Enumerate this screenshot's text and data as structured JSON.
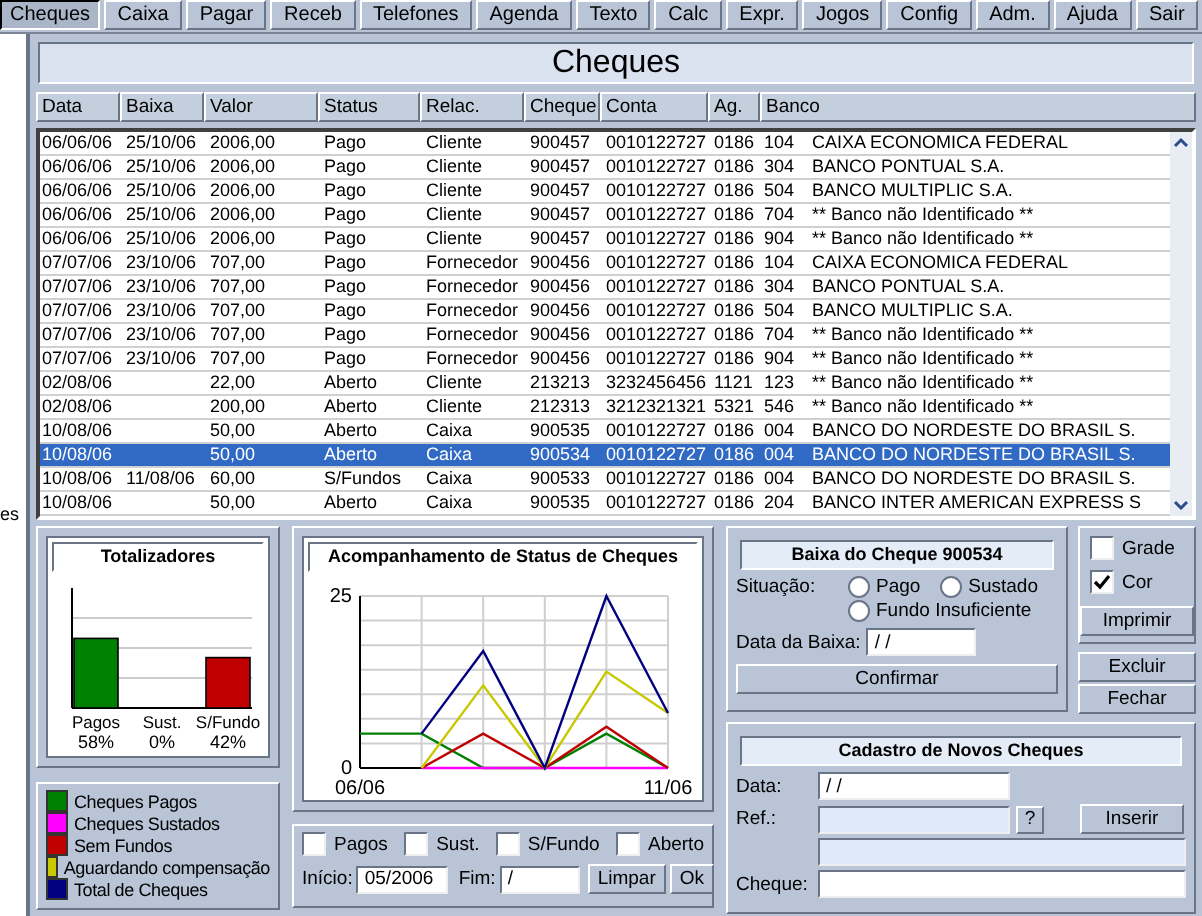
{
  "menu": [
    {
      "label": "Cheques",
      "selected": true
    },
    {
      "label": "Caixa",
      "selected": false
    },
    {
      "label": "Pagar",
      "selected": false
    },
    {
      "label": "Receb",
      "selected": false
    },
    {
      "label": "Telefones",
      "selected": false
    },
    {
      "label": "Agenda",
      "selected": false
    },
    {
      "label": "Texto",
      "selected": false
    },
    {
      "label": "Calc",
      "selected": false
    },
    {
      "label": "Expr.",
      "selected": false
    },
    {
      "label": "Jogos",
      "selected": false
    },
    {
      "label": "Config",
      "selected": false
    },
    {
      "label": "Adm.",
      "selected": false
    },
    {
      "label": "Ajuda",
      "selected": false
    },
    {
      "label": "Sair",
      "selected": false
    }
  ],
  "side_fragment": "es",
  "title": "Cheques",
  "table": {
    "columns": [
      "Data",
      "Baixa",
      "Valor",
      "Status",
      "Relac.",
      "Cheque",
      "Conta",
      "Ag.",
      "Banco"
    ],
    "rows": [
      {
        "data": "06/06/06",
        "baixa": "25/10/06",
        "valor": "2006,00",
        "status": "Pago",
        "relac": "Cliente",
        "cheque": "900457",
        "conta": "0010122727",
        "ag": "0186",
        "banco_code": "104",
        "banco_name": "CAIXA ECONOMICA FEDERAL",
        "selected": false
      },
      {
        "data": "06/06/06",
        "baixa": "25/10/06",
        "valor": "2006,00",
        "status": "Pago",
        "relac": "Cliente",
        "cheque": "900457",
        "conta": "0010122727",
        "ag": "0186",
        "banco_code": "304",
        "banco_name": "BANCO PONTUAL S.A.",
        "selected": false
      },
      {
        "data": "06/06/06",
        "baixa": "25/10/06",
        "valor": "2006,00",
        "status": "Pago",
        "relac": "Cliente",
        "cheque": "900457",
        "conta": "0010122727",
        "ag": "0186",
        "banco_code": "504",
        "banco_name": "BANCO MULTIPLIC S.A.",
        "selected": false
      },
      {
        "data": "06/06/06",
        "baixa": "25/10/06",
        "valor": "2006,00",
        "status": "Pago",
        "relac": "Cliente",
        "cheque": "900457",
        "conta": "0010122727",
        "ag": "0186",
        "banco_code": "704",
        "banco_name": "** Banco não Identificado **",
        "selected": false
      },
      {
        "data": "06/06/06",
        "baixa": "25/10/06",
        "valor": "2006,00",
        "status": "Pago",
        "relac": "Cliente",
        "cheque": "900457",
        "conta": "0010122727",
        "ag": "0186",
        "banco_code": "904",
        "banco_name": "** Banco não Identificado **",
        "selected": false
      },
      {
        "data": "07/07/06",
        "baixa": "23/10/06",
        "valor": "707,00",
        "status": "Pago",
        "relac": "Fornecedor",
        "cheque": "900456",
        "conta": "0010122727",
        "ag": "0186",
        "banco_code": "104",
        "banco_name": "CAIXA ECONOMICA FEDERAL",
        "selected": false
      },
      {
        "data": "07/07/06",
        "baixa": "23/10/06",
        "valor": "707,00",
        "status": "Pago",
        "relac": "Fornecedor",
        "cheque": "900456",
        "conta": "0010122727",
        "ag": "0186",
        "banco_code": "304",
        "banco_name": "BANCO PONTUAL S.A.",
        "selected": false
      },
      {
        "data": "07/07/06",
        "baixa": "23/10/06",
        "valor": "707,00",
        "status": "Pago",
        "relac": "Fornecedor",
        "cheque": "900456",
        "conta": "0010122727",
        "ag": "0186",
        "banco_code": "504",
        "banco_name": "BANCO MULTIPLIC S.A.",
        "selected": false
      },
      {
        "data": "07/07/06",
        "baixa": "23/10/06",
        "valor": "707,00",
        "status": "Pago",
        "relac": "Fornecedor",
        "cheque": "900456",
        "conta": "0010122727",
        "ag": "0186",
        "banco_code": "704",
        "banco_name": "** Banco não Identificado **",
        "selected": false
      },
      {
        "data": "07/07/06",
        "baixa": "23/10/06",
        "valor": "707,00",
        "status": "Pago",
        "relac": "Fornecedor",
        "cheque": "900456",
        "conta": "0010122727",
        "ag": "0186",
        "banco_code": "904",
        "banco_name": "** Banco não Identificado **",
        "selected": false
      },
      {
        "data": "02/08/06",
        "valor": "22,00",
        "status": "Aberto",
        "relac": "Cliente",
        "cheque": "213213",
        "conta": "3232456456",
        "ag": "1121",
        "banco_code": "123",
        "banco_name": "** Banco não Identificado **",
        "selected": false
      },
      {
        "data": "02/08/06",
        "valor": "200,00",
        "status": "Aberto",
        "relac": "Cliente",
        "cheque": "212313",
        "conta": "3212321321",
        "ag": "5321",
        "banco_code": "546",
        "banco_name": "** Banco não Identificado **",
        "selected": false
      },
      {
        "data": "10/08/06",
        "valor": "50,00",
        "status": "Aberto",
        "relac": "Caixa",
        "cheque": "900535",
        "conta": "0010122727",
        "ag": "0186",
        "banco_code": "004",
        "banco_name": "BANCO DO NORDESTE DO BRASIL S.",
        "selected": false
      },
      {
        "data": "10/08/06",
        "valor": "50,00",
        "status": "Aberto",
        "relac": "Caixa",
        "cheque": "900534",
        "conta": "0010122727",
        "ag": "0186",
        "banco_code": "004",
        "banco_name": "BANCO DO NORDESTE DO BRASIL S.",
        "selected": true
      },
      {
        "data": "10/08/06",
        "baixa": "11/08/06",
        "valor": "60,00",
        "status": "S/Fundos",
        "relac": "Caixa",
        "cheque": "900533",
        "conta": "0010122727",
        "ag": "0186",
        "banco_code": "004",
        "banco_name": "BANCO DO NORDESTE DO BRASIL S.",
        "selected": false
      },
      {
        "data": "10/08/06",
        "valor": "50,00",
        "status": "Aberto",
        "relac": "Caixa",
        "cheque": "900535",
        "conta": "0010122727",
        "ag": "0186",
        "banco_code": "204",
        "banco_name": "BANCO INTER AMERICAN EXPRESS S",
        "selected": false
      }
    ]
  },
  "totals": {
    "title": "Totalizadores",
    "chart_data": {
      "type": "bar",
      "categories": [
        "Pagos",
        "Sust.",
        "S/Fundo"
      ],
      "values": [
        58,
        0,
        42
      ],
      "ylim": [
        0,
        100
      ],
      "value_labels": [
        "58%",
        "0%",
        "42%"
      ]
    }
  },
  "status_chart": {
    "title": "Acompanhamento de Status de Cheques",
    "chart_data": {
      "type": "line",
      "grid": true,
      "categories": [
        "06/06",
        null,
        null,
        null,
        null,
        "11/06"
      ],
      "yticks": [
        0,
        25
      ],
      "ylim": [
        0,
        25
      ],
      "series": [
        {
          "name": "Cheques Pagos",
          "color": "#008000",
          "values": [
            5,
            5,
            0,
            0,
            5,
            0
          ]
        },
        {
          "name": "Cheques Sustados",
          "color": "#ff00ff",
          "values": [
            null,
            0,
            0,
            0,
            0,
            0
          ]
        },
        {
          "name": "Sem Fundos",
          "color": "#c00000",
          "values": [
            null,
            0,
            5,
            0,
            6,
            0
          ]
        },
        {
          "name": "Aguardando compensação",
          "color": "#c8c800",
          "values": [
            null,
            0,
            12,
            0,
            14,
            8
          ]
        },
        {
          "name": "Total de Cheques",
          "color": "#000080",
          "values": [
            null,
            5,
            17,
            0,
            25,
            8
          ]
        }
      ]
    }
  },
  "filters": {
    "checks": [
      {
        "label": "Pagos",
        "checked": false
      },
      {
        "label": "Sust.",
        "checked": false
      },
      {
        "label": "S/Fundo",
        "checked": false
      },
      {
        "label": "Aberto",
        "checked": false
      }
    ],
    "start": {
      "label": "Início:",
      "value": "05/2006"
    },
    "end": {
      "label": "Fim:",
      "value": "/"
    },
    "buttons": [
      "Limpar",
      "Ok"
    ]
  },
  "baixa": {
    "title": "Baixa do Cheque 900534",
    "situacao_label": "Situação:",
    "options": [
      {
        "label": "Pago",
        "selected": false
      },
      {
        "label": "Sustado",
        "selected": false
      },
      {
        "label": "Fundo Insuficiente",
        "selected": false
      }
    ],
    "date_label": "Data da Baixa:",
    "date_value": "/ /",
    "confirm": "Confirmar"
  },
  "options": {
    "checks": [
      {
        "label": "Grade",
        "checked": false
      },
      {
        "label": "Cor",
        "checked": true
      }
    ],
    "print": "Imprimir"
  },
  "actions": [
    "Excluir",
    "Fechar"
  ],
  "cadastro": {
    "title": "Cadastro de Novos Cheques",
    "date": {
      "label": "Data:",
      "value": "/ /"
    },
    "ref": {
      "label": "Ref.:"
    },
    "ref_button": "?",
    "insert": "Inserir",
    "cheque": {
      "label": "Cheque:"
    }
  }
}
